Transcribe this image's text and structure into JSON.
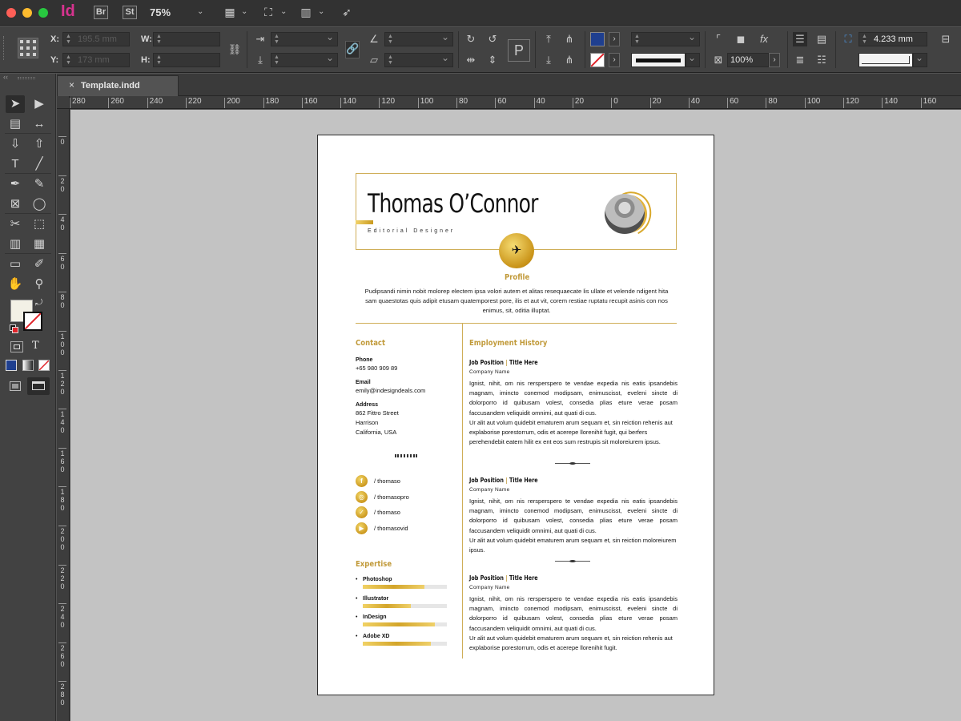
{
  "app": {
    "id": "Id",
    "bridge": "Br",
    "stock": "St",
    "zoom": "75%"
  },
  "control": {
    "x_label": "X:",
    "y_label": "Y:",
    "w_label": "W:",
    "h_label": "H:",
    "x_value": "195.5 mm",
    "y_value": "173 mm",
    "stroke_weight": "4.233 mm",
    "opacity": "100%",
    "fill_color": "#1f3f8f",
    "icons": [
      "constrain-link-icon",
      "rotate-icon",
      "shear-icon",
      "flip-icon",
      "effects-icon",
      "text-wrap-icon"
    ]
  },
  "tab": {
    "title": "Template.indd",
    "close": "×"
  },
  "rulers": {
    "h_ticks": [
      "280",
      "260",
      "240",
      "220",
      "200",
      "180",
      "160",
      "140",
      "120",
      "100",
      "80",
      "60",
      "40",
      "20",
      "0",
      "20",
      "40",
      "60",
      "80",
      "100",
      "120",
      "140",
      "160"
    ],
    "v_ticks": [
      "0",
      "2 0",
      "4 0",
      "6 0",
      "8 0",
      "1 0 0",
      "1 2 0",
      "1 4 0",
      "1 6 0",
      "1 8 0",
      "2 0 0",
      "2 2 0",
      "2 4 0",
      "2 6 0",
      "2 8 0"
    ]
  },
  "tools": [
    {
      "name": "selection-tool",
      "glyph": "➤"
    },
    {
      "name": "direct-selection-tool",
      "glyph": "▶"
    },
    {
      "name": "page-tool",
      "glyph": "▤"
    },
    {
      "name": "gap-tool",
      "glyph": "↔"
    },
    {
      "name": "content-collector-tool",
      "glyph": "⇩"
    },
    {
      "name": "content-placer-tool",
      "glyph": "⇧"
    },
    {
      "name": "type-tool",
      "glyph": "T"
    },
    {
      "name": "line-tool",
      "glyph": "╱"
    },
    {
      "name": "pen-tool",
      "glyph": "✒"
    },
    {
      "name": "pencil-tool",
      "glyph": "✎"
    },
    {
      "name": "rectangle-frame-tool",
      "glyph": "⊠"
    },
    {
      "name": "ellipse-tool",
      "glyph": "◯"
    },
    {
      "name": "scissors-tool",
      "glyph": "✂"
    },
    {
      "name": "free-transform-tool",
      "glyph": "⬚"
    },
    {
      "name": "gradient-swatch-tool",
      "glyph": "▥"
    },
    {
      "name": "gradient-feather-tool",
      "glyph": "▦"
    },
    {
      "name": "note-tool",
      "glyph": "▭"
    },
    {
      "name": "eyedropper-tool",
      "glyph": "✐"
    },
    {
      "name": "hand-tool",
      "glyph": "✋"
    },
    {
      "name": "zoom-tool",
      "glyph": "⚲"
    }
  ],
  "resume": {
    "name": "Thomas O’Connor",
    "subtitle": "Editorial Designer",
    "profile_title": "Profile",
    "profile_text": "Pudipsandi nimin nobit molorep electem ipsa volori autem et alitas resequaecate lis ullate et velende ndigent hita sam quaestotas quis adipit etusam quatemporest pore, ilis et aut vit, corem restiae ruptatu recupit asinis con nos enimus, sit, oditia illuptat.",
    "contact_title": "Contact",
    "phone_label": "Phone",
    "phone": "+65 980 909 89",
    "email_label": "Email",
    "email": "emily@indesigndeals.com",
    "address_label": "Address",
    "address_1": "862  Fittro Street",
    "address_2": "Harrison",
    "address_3": "California, USA",
    "social": [
      {
        "icon": "facebook-icon",
        "glyph": "f",
        "handle": "/ thomaso"
      },
      {
        "icon": "instagram-icon",
        "glyph": "◎",
        "handle": "/ thomasopro"
      },
      {
        "icon": "twitter-icon",
        "glyph": "✓",
        "handle": "/ thomaso"
      },
      {
        "icon": "youtube-icon",
        "glyph": "▶",
        "handle": "/ thomasovid"
      }
    ],
    "expertise_title": "Expertise",
    "skills": [
      {
        "name": "Photoshop",
        "level": 0.73
      },
      {
        "name": "Illustrator",
        "level": 0.57
      },
      {
        "name": "InDesign",
        "level": 0.86
      },
      {
        "name": "Adobe XD",
        "level": 0.81
      }
    ],
    "employment_title": "Employment History",
    "jobs": [
      {
        "position": "Job Position",
        "sep": "|",
        "title": "Title Here",
        "company": "Company Name",
        "p1": "Ignist, nihit, om nis rersperspero te vendae expedia nis eatis ipsandebis magnam, imincto conemod modipsam, enimuscisst, eveleni sincte di dolorporro id quibusam volest, consedia plias eture verae posam faccusandem veliquidit omnimi, aut quati di cus.",
        "p2": "Ur alit aut volum quidebit ematurem arum sequam et, sin reiction rehenis aut explaborise porestorrum, odis et acerepe llorenihit fugit, qui berfers perehendebit eatem hilit ex ent eos sum restrupis sit moloreiurem ipsus."
      },
      {
        "position": "Job Position",
        "sep": "|",
        "title": "Title Here",
        "company": "Company Name",
        "p1": "Ignist, nihit, om nis rersperspero te vendae expedia nis eatis ipsandebis magnam, imincto conemod modipsam, enimuscisst, eveleni sincte di dolorporro id quibusam volest, consedia plias eture verae posam faccusandem veliquidit omnimi, aut quati di cus.",
        "p2": "Ur alit aut volum quidebit ematurem arum sequam et, sin reiction moloreiurem ipsus."
      },
      {
        "position": "Job Position",
        "sep": "|",
        "title": "Title Here",
        "company": "Company Name",
        "p1": "Ignist, nihit, om nis rersperspero te vendae expedia nis eatis ipsandebis magnam, imincto conemod modipsam, enimuscisst, eveleni sincte di dolorporro id quibusam volest, consedia plias eture verae posam faccusandem veliquidit omnimi, aut quati di cus.",
        "p2": "Ur alit aut volum quidebit ematurem arum sequam et, sin reiction rehenis aut explaborise porestorrum, odis et acerepe llorenihit fugit."
      }
    ]
  }
}
